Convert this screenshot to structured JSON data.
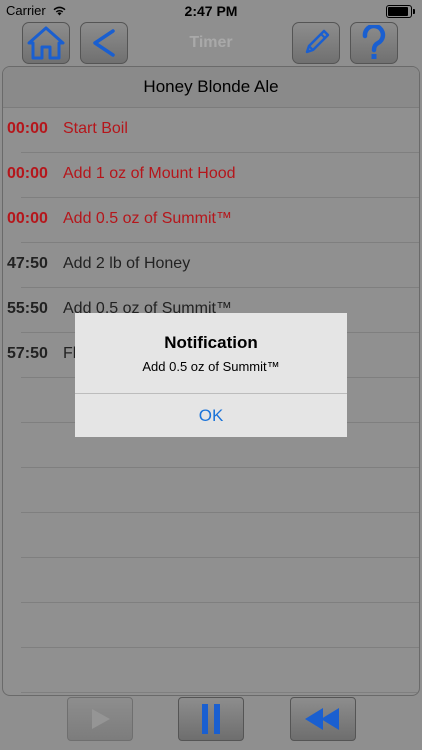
{
  "status_bar": {
    "carrier": "Carrier",
    "time": "2:47 PM"
  },
  "toolbar": {
    "title": "Timer",
    "home_icon": "home-icon",
    "back_icon": "chevron-left-icon",
    "edit_icon": "pencil-icon",
    "help_icon": "question-icon"
  },
  "recipe": {
    "name": "Honey Blonde Ale"
  },
  "steps": [
    {
      "time": "00:00",
      "text": "Start Boil"
    },
    {
      "time": "00:00",
      "text": "Add 1 oz of Mount Hood"
    },
    {
      "time": "00:00",
      "text": "Add 0.5 oz of Summit™"
    },
    {
      "time": "47:50",
      "text": "Add 2 lb of Honey"
    },
    {
      "time": "55:50",
      "text": "Add 0.5 oz of Summit™"
    },
    {
      "time": "57:50",
      "text": "Fl"
    }
  ],
  "colors": {
    "completed": "#b5161b",
    "pending": "#222222",
    "accent_blue": "#1a5fd0"
  },
  "controls": {
    "play_icon": "play-icon",
    "pause_icon": "pause-icon",
    "rewind_icon": "rewind-icon"
  },
  "alert": {
    "title": "Notification",
    "message": "Add 0.5 oz of Summit™",
    "ok_label": "OK"
  }
}
